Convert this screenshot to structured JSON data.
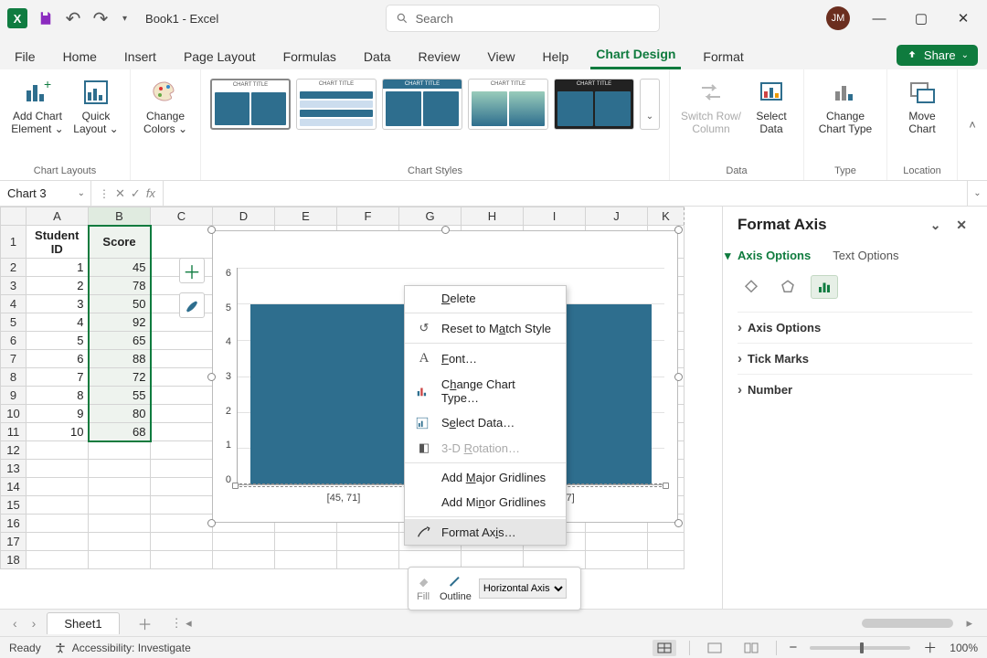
{
  "titlebar": {
    "title": "Book1  -  Excel",
    "search_placeholder": "Search",
    "avatar": "JM"
  },
  "win": {
    "min": "—",
    "max": "▢",
    "close": "✕"
  },
  "tabs": {
    "file": "File",
    "home": "Home",
    "insert": "Insert",
    "page_layout": "Page Layout",
    "formulas": "Formulas",
    "data": "Data",
    "review": "Review",
    "view": "View",
    "help": "Help",
    "chart_design": "Chart Design",
    "format": "Format",
    "share": "Share"
  },
  "ribbon": {
    "add_chart_element": "Add Chart Element ⌄",
    "quick_layout": "Quick Layout ⌄",
    "change_colors": "Change Colors ⌄",
    "switch_row": "Switch Row/ Column",
    "select_data": "Select Data",
    "change_type": "Change Chart Type",
    "move_chart": "Move Chart",
    "g_chart_layouts": "Chart Layouts",
    "g_chart_styles": "Chart Styles",
    "g_data": "Data",
    "g_type": "Type",
    "g_location": "Location"
  },
  "namebox": "Chart 3",
  "fx": {
    "cancel": "✕",
    "confirm": "✓",
    "label": "fx"
  },
  "columns": [
    "A",
    "B",
    "C",
    "D",
    "E",
    "F",
    "G",
    "H",
    "I",
    "J",
    "K"
  ],
  "headers": {
    "a": "Student ID",
    "b": "Score"
  },
  "rows": [
    {
      "r": 1
    },
    {
      "r": 2,
      "a": "1",
      "b": "45"
    },
    {
      "r": 3,
      "a": "2",
      "b": "78"
    },
    {
      "r": 4,
      "a": "3",
      "b": "50"
    },
    {
      "r": 5,
      "a": "4",
      "b": "92"
    },
    {
      "r": 6,
      "a": "5",
      "b": "65"
    },
    {
      "r": 7,
      "a": "6",
      "b": "88"
    },
    {
      "r": 8,
      "a": "7",
      "b": "72"
    },
    {
      "r": 9,
      "a": "8",
      "b": "55"
    },
    {
      "r": 10,
      "a": "9",
      "b": "80"
    },
    {
      "r": 11,
      "a": "10",
      "b": "68"
    }
  ],
  "chart_data": {
    "type": "bar",
    "title": "",
    "xlabel": "",
    "ylabel": "",
    "ylim": [
      0,
      6
    ],
    "yticks": [
      0,
      1,
      2,
      3,
      4,
      5,
      6
    ],
    "categories": [
      "[45, 71]",
      "(71, 97]"
    ],
    "values": [
      5,
      5
    ]
  },
  "yaxis_vals": [
    "6",
    "5",
    "4",
    "3",
    "2",
    "1",
    "0"
  ],
  "context_menu": {
    "delete": "Delete",
    "reset": "Reset to Match Style",
    "font": "Font…",
    "change_type": "Change Chart Type…",
    "select_data": "Select Data…",
    "rotation": "3-D Rotation…",
    "major": "Add Major Gridlines",
    "minor": "Add Minor Gridlines",
    "format_axis": "Format Axis…"
  },
  "minibar": {
    "fill": "Fill",
    "outline": "Outline",
    "axis_dropdown": "Horizontal Axis"
  },
  "pane": {
    "title": "Format Axis",
    "axis_options": "Axis Options",
    "text_options": "Text Options",
    "s1": "Axis Options",
    "s2": "Tick Marks",
    "s3": "Number"
  },
  "sheettab": {
    "name": "Sheet1",
    "add": "＋"
  },
  "status": {
    "ready": "Ready",
    "accessibility": "Accessibility: Investigate",
    "zoom": "100%",
    "zm_minus": "−",
    "zm_plus": "＋"
  }
}
